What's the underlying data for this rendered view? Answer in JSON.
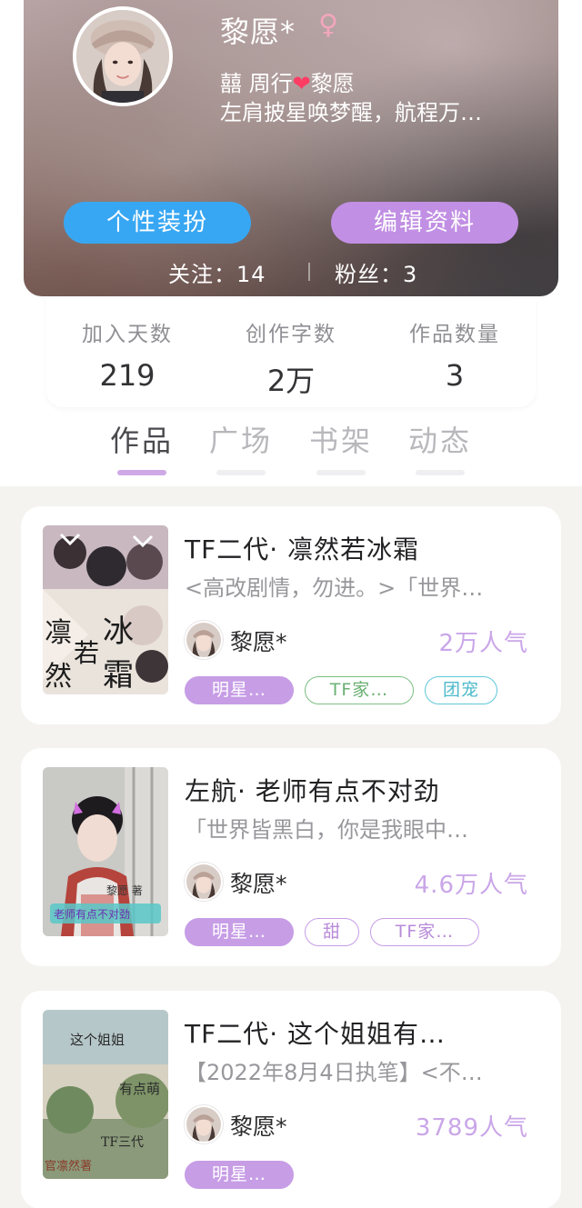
{
  "profile": {
    "username": "黎愿*",
    "gender_icon": "♀",
    "bio_line1_a": "囍 周行",
    "bio_heart": "❤",
    "bio_line1_b": "黎愿",
    "bio_line2": "左肩披星唤梦醒，航程万…",
    "dress_button": "个性装扮",
    "edit_button": "编辑资料",
    "following": "关注：14",
    "followers": "粉丝：3"
  },
  "stats": [
    {
      "label": "加入天数",
      "value": "219"
    },
    {
      "label": "创作字数",
      "value": "2万"
    },
    {
      "label": "作品数量",
      "value": "3"
    }
  ],
  "tabs": [
    {
      "label": "作品",
      "active": true
    },
    {
      "label": "广场",
      "active": false
    },
    {
      "label": "书架",
      "active": false
    },
    {
      "label": "动态",
      "active": false
    }
  ],
  "works": [
    {
      "title": "TF二代· 凛然若冰霜",
      "desc": "<高改剧情，勿进。>「世界…",
      "author": "黎愿*",
      "popularity": "2万人气",
      "cover_text": [
        "凛",
        "若",
        "冰",
        "然",
        "霜"
      ],
      "tags": [
        "明星…",
        "TF家…",
        "团宠"
      ]
    },
    {
      "title": "左航· 老师有点不对劲",
      "desc": "「世界皆黑白，你是我眼中…",
      "author": "黎愿*",
      "popularity": "4.6万人气",
      "cover_text": [
        "老师有点不对劲",
        "黎愿 著"
      ],
      "tags": [
        "明星…",
        "甜",
        "TF家…"
      ]
    },
    {
      "title": "TF二代· 这个姐姐有…",
      "desc": "【2022年8月4日执笔】<不…",
      "author": "黎愿*",
      "popularity": "3789人气",
      "cover_text": [
        "这个姐姐",
        "有点萌",
        "官凛然著",
        "TF三代"
      ],
      "tags": [
        "明星…"
      ]
    }
  ],
  "colors": {
    "accent_blue": "#38a7f3",
    "accent_purple": "#c18fe3",
    "popularity": "#caa6e8",
    "tab_active_indicator": "#cfa9e6"
  }
}
